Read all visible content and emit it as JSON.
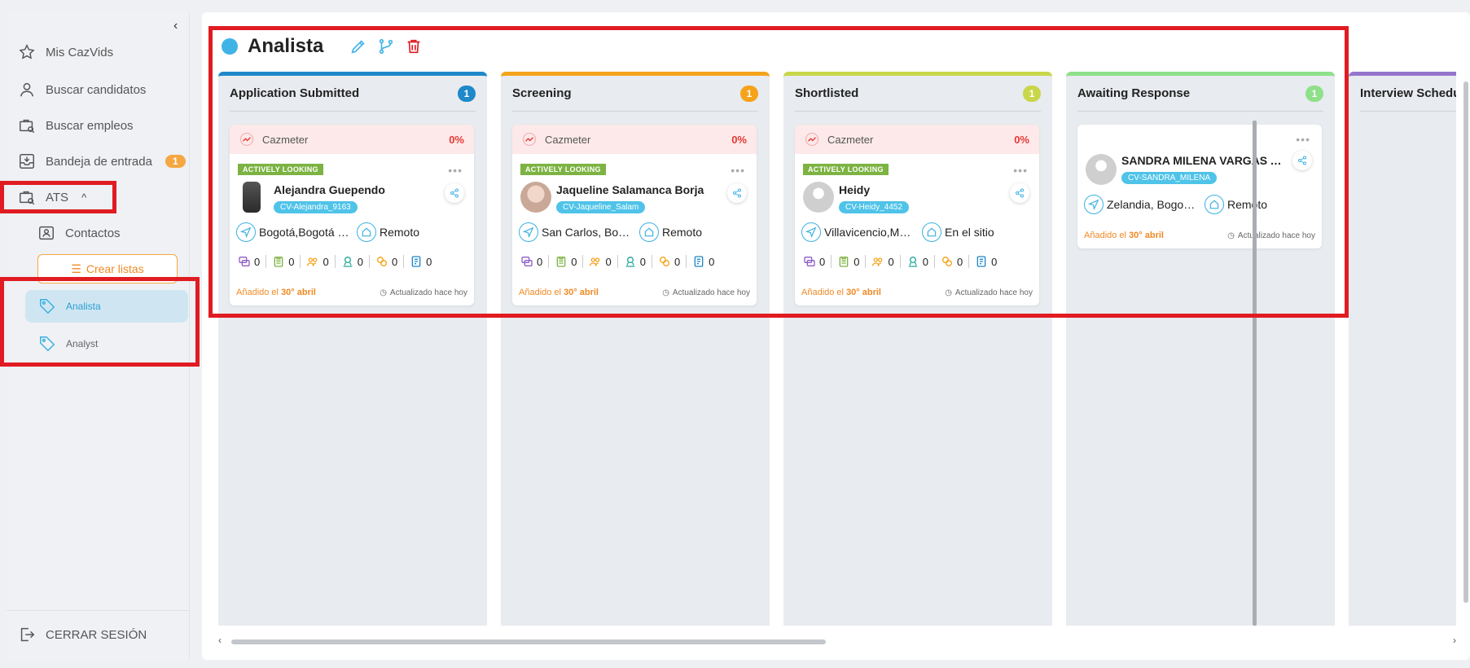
{
  "sidebar": {
    "items": [
      {
        "label": "Mis CazVids",
        "icon": "star-icon"
      },
      {
        "label": "Buscar candidatos",
        "icon": "user-icon"
      },
      {
        "label": "Buscar empleos",
        "icon": "briefcase-search-icon"
      },
      {
        "label": "Bandeja de entrada",
        "icon": "inbox-icon",
        "badge": "1"
      },
      {
        "label": "ATS",
        "icon": "briefcase-icon"
      }
    ],
    "contacts_label": "Contactos",
    "create_list_label": "Crear listas",
    "lists": [
      {
        "label": "Analista",
        "active": true
      },
      {
        "label": "Analyst",
        "active": false
      }
    ],
    "logout_label": "CERRAR SESIÓN"
  },
  "header": {
    "title": "Analista",
    "dot_color": "#40b3e6"
  },
  "columns": [
    {
      "title": "Application Submitted",
      "count": "1",
      "color": "#1e88c9",
      "card": {
        "cazmeter_label": "Cazmeter",
        "cazmeter_pct": "0%",
        "status_tag": "ACTIVELY LOOKING",
        "name": "Alejandra Guependo",
        "cv": "CV-Alejandra_9163",
        "location": "Bogotá,Bogotá D.C...",
        "work_mode": "Remoto",
        "stats": [
          "0",
          "0",
          "0",
          "0",
          "0",
          "0"
        ],
        "added_prefix": "Añadido el",
        "added_date": "30° abril",
        "updated": "Actualizado hace hoy",
        "avatar": "photo"
      }
    },
    {
      "title": "Screening",
      "count": "1",
      "color": "#f5a31a",
      "card": {
        "cazmeter_label": "Cazmeter",
        "cazmeter_pct": "0%",
        "status_tag": "ACTIVELY LOOKING",
        "name": "Jaqueline Salamanca Borja",
        "cv": "CV-Jaqueline_Salam",
        "location": "San Carlos, Bogotá...",
        "work_mode": "Remoto",
        "stats": [
          "0",
          "0",
          "0",
          "0",
          "0",
          "0"
        ],
        "added_prefix": "Añadido el",
        "added_date": "30° abril",
        "updated": "Actualizado hace hoy",
        "avatar": "photo"
      }
    },
    {
      "title": "Shortlisted",
      "count": "1",
      "color": "#c9d64a",
      "card": {
        "cazmeter_label": "Cazmeter",
        "cazmeter_pct": "0%",
        "status_tag": "ACTIVELY LOOKING",
        "name": "Heidy",
        "cv": "CV-Heidy_4452",
        "location": "Villavicencio,Meta...",
        "work_mode": "En el sitio",
        "stats": [
          "0",
          "0",
          "0",
          "0",
          "0",
          "0"
        ],
        "added_prefix": "Añadido el",
        "added_date": "30° abril",
        "updated": "Actualizado hace hoy",
        "avatar": "placeholder"
      }
    },
    {
      "title": "Awaiting Response",
      "count": "1",
      "color": "#8fe08a",
      "card": {
        "name": "SANDRA MILENA VARGAS A...",
        "cv": "CV-SANDRA_MILENA",
        "location": "Zelandia, Bogota ...",
        "work_mode": "Remoto",
        "added_prefix": "Añadido el",
        "added_date": "30° abril",
        "updated": "Actualizado hace hoy",
        "avatar": "placeholder"
      }
    },
    {
      "title": "Interview Schedule",
      "color": "#9575cd"
    }
  ]
}
